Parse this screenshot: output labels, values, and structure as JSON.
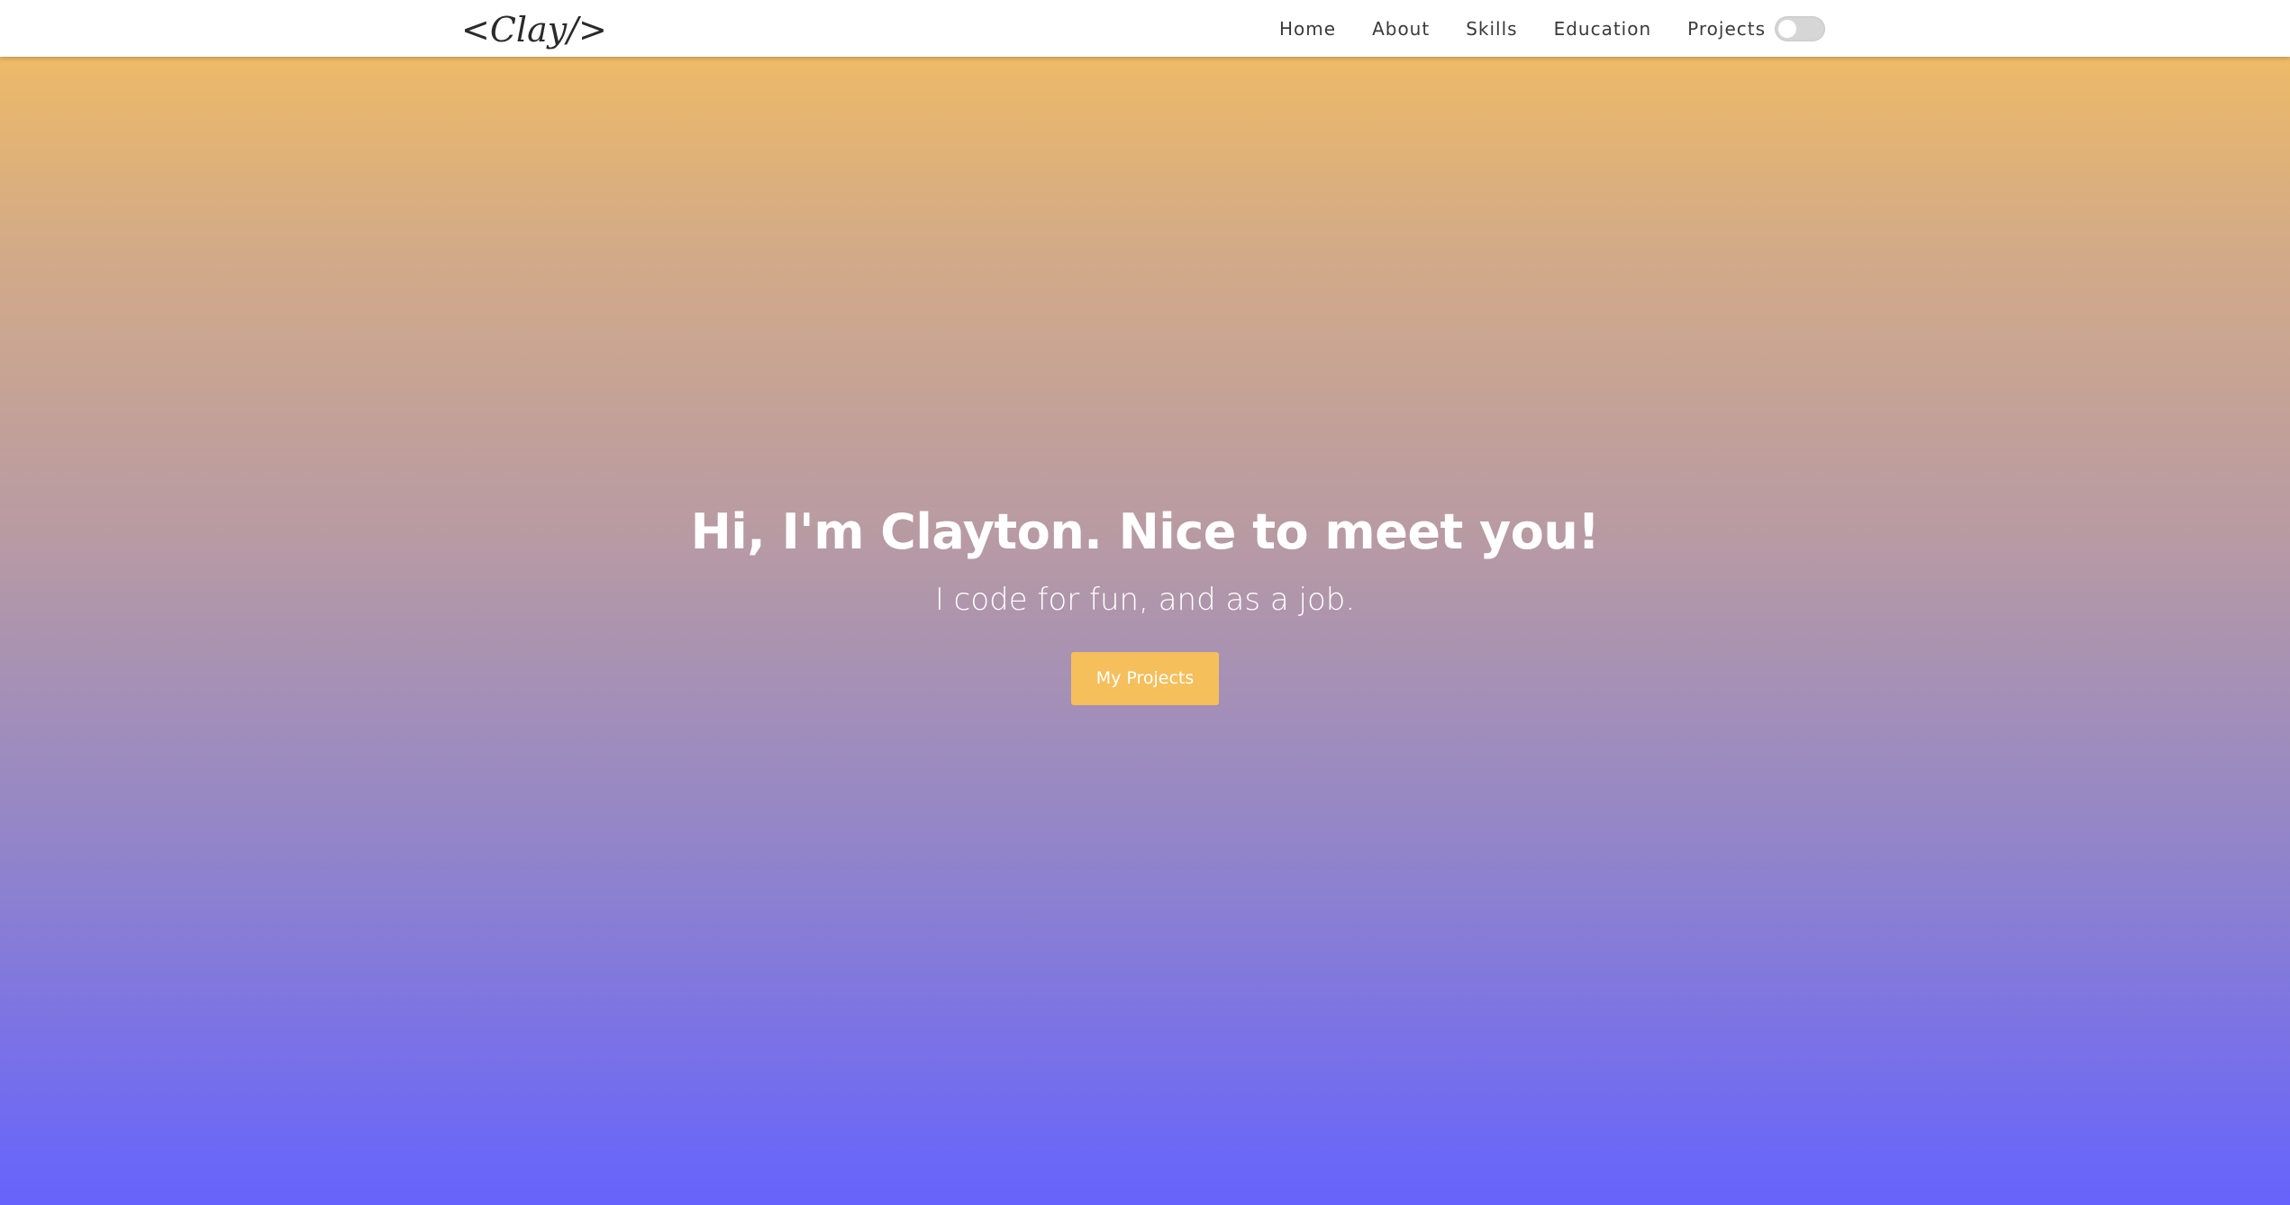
{
  "navbar": {
    "logo": "<Clay/>",
    "links": [
      "Home",
      "About",
      "Skills",
      "Education",
      "Projects"
    ],
    "dark_mode_toggle": {
      "state": "off",
      "icon": "toggle-switch-icon"
    }
  },
  "hero": {
    "title": "Hi, I'm Clayton. Nice to meet you!",
    "subtitle": "I code for fun, and as a job.",
    "button_label": "My Projects"
  },
  "colors": {
    "gradient_top": "#f5bf5c",
    "gradient_bottom": "#6663fd",
    "button": "#f5bf5c",
    "navbar": "#ffffff",
    "text": "#ffffff"
  }
}
